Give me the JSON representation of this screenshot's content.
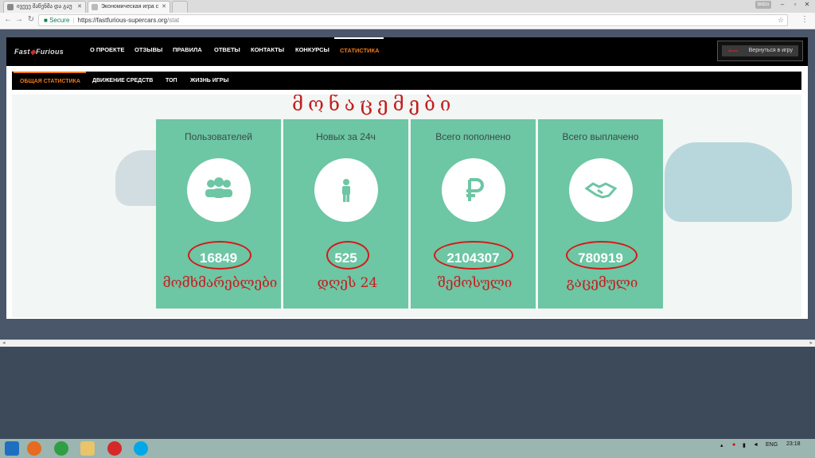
{
  "browser": {
    "tabs": [
      {
        "label": "ივეეე მაწენმა და გაუ"
      },
      {
        "label": "Экономическая игра с"
      }
    ],
    "profile_label": "bidzo",
    "url": {
      "secure_label": "Secure",
      "origin": "https://fastfurious-supercars.org",
      "path": "/stat"
    }
  },
  "site": {
    "logo": {
      "part1": "Fast",
      "part2": "Furious"
    },
    "nav": [
      "О ПРОЕКТЕ",
      "ОТЗЫВЫ",
      "ПРАВИЛА",
      "ОТВЕТЫ",
      "КОНТАКТЫ",
      "КОНКУРСЫ",
      "СТАТИСТИКА"
    ],
    "back_button": "Вернуться в игру",
    "subnav": [
      "ОБЩАЯ СТАТИСТИКА",
      "ДВИЖЕНИЕ СРЕДСТВ",
      "ТОП",
      "ЖИЗНЬ ИГРЫ"
    ],
    "annotation_heading": "მონაცემები",
    "stats": [
      {
        "title": "Пользователей",
        "value": "16849",
        "icon": "users-icon",
        "note": "მომხმარებლები"
      },
      {
        "title": "Новых за 24ч",
        "value": "525",
        "icon": "person-icon",
        "note": "დღეს 24"
      },
      {
        "title": "Всего пополнено",
        "value": "2104307",
        "icon": "ruble-icon",
        "note": "შემოსული"
      },
      {
        "title": "Всего выплачено",
        "value": "780919",
        "icon": "handshake-icon",
        "note": "გაცემული"
      }
    ]
  },
  "taskbar": {
    "language": "ENG",
    "time": "23:18"
  },
  "colors": {
    "accent": "#f07a18",
    "stat_bg": "#6dc6a4",
    "annotation_red": "#c41e1e"
  }
}
